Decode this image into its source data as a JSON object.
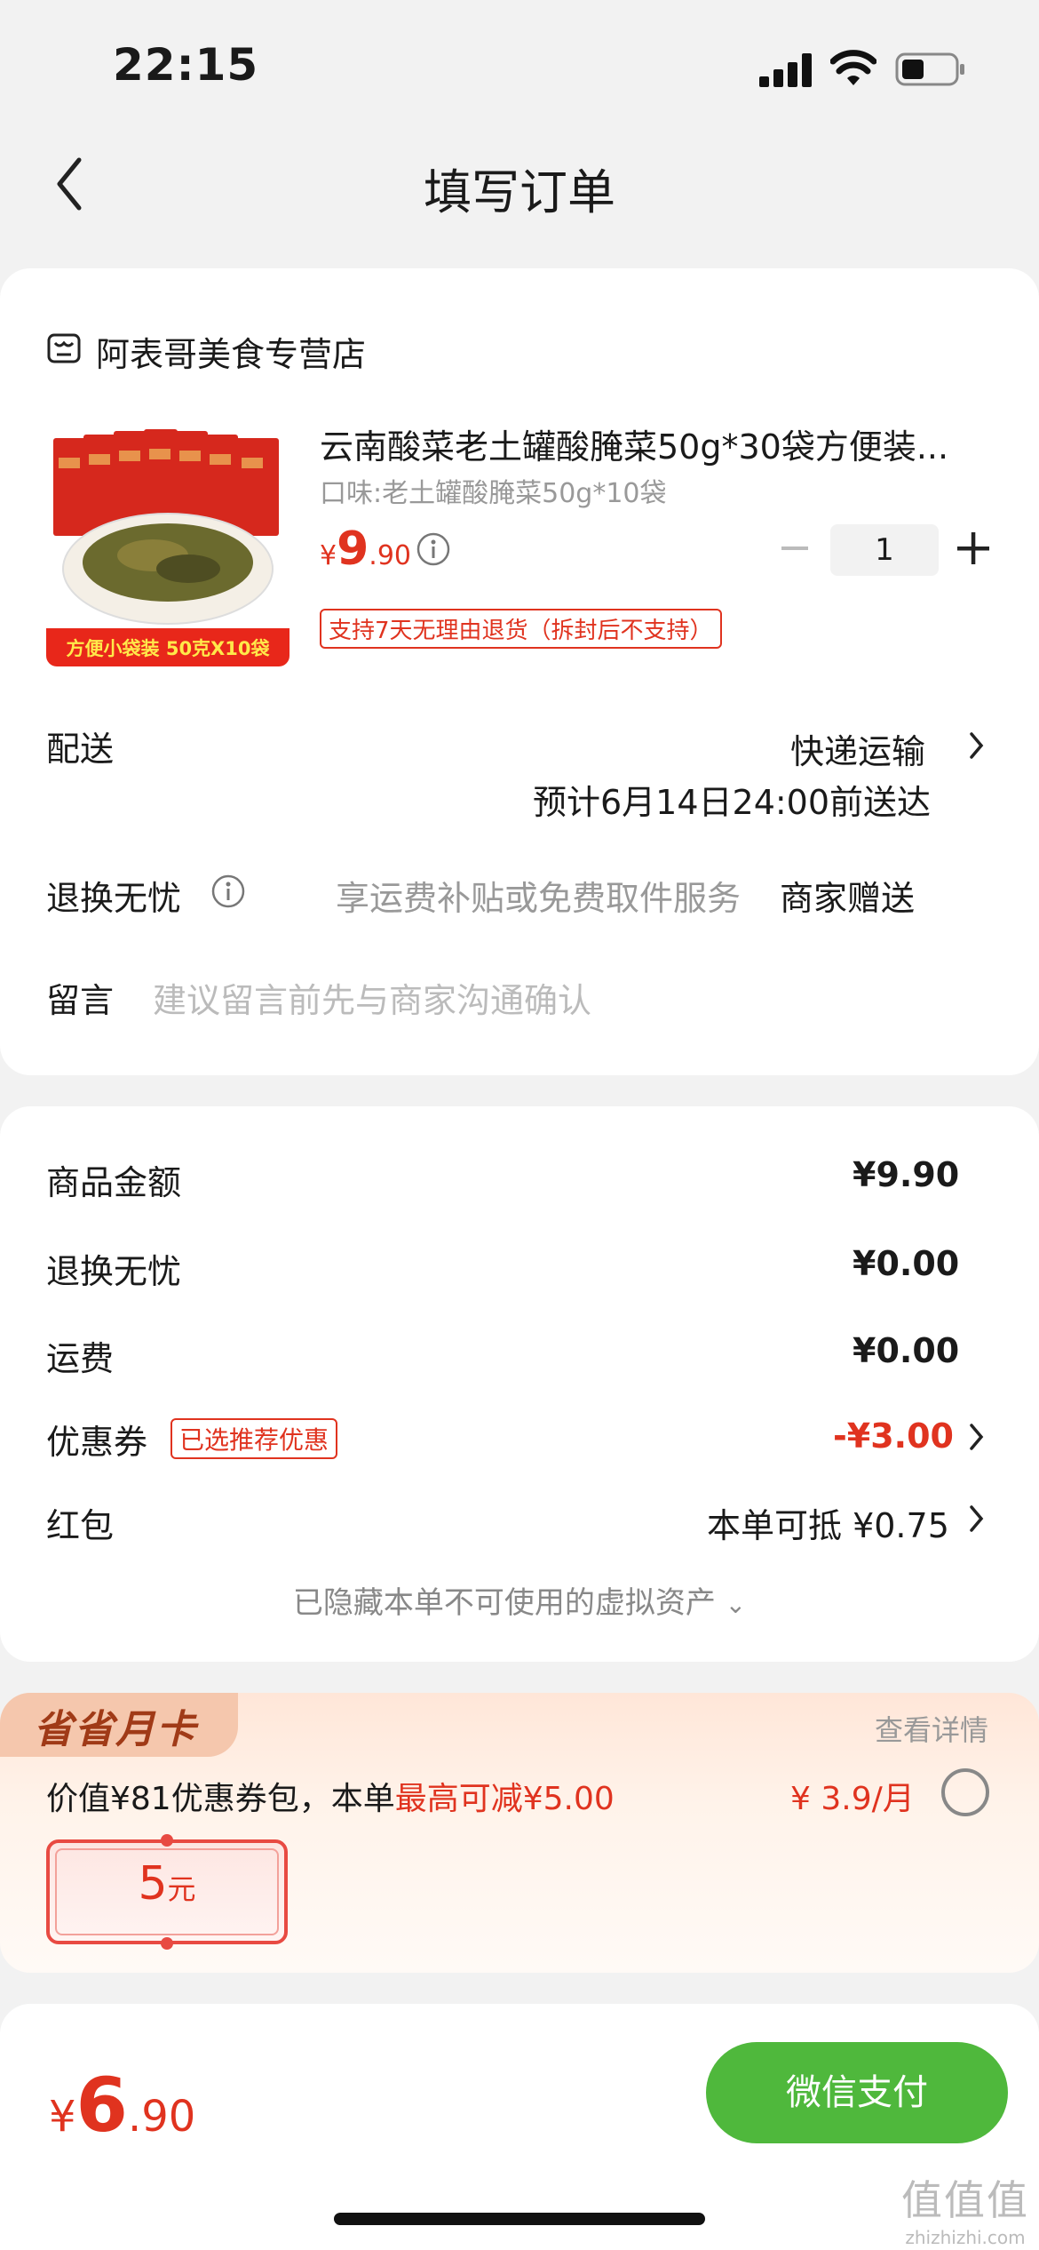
{
  "status_bar": {
    "time": "22:15"
  },
  "nav": {
    "title": "填写订单"
  },
  "store": {
    "name": "阿表哥美食专营店"
  },
  "product": {
    "name": "云南酸菜老土罐酸腌菜50g*30袋方便装...",
    "spec": "口味:老土罐酸腌菜50g*10袋",
    "price_currency": "¥",
    "price_int": "9",
    "price_dec": ".90",
    "quantity": "1",
    "return_tag": "支持7天无理由退货（拆封后不支持）",
    "image_banner": "方便小袋装 50克X10袋"
  },
  "delivery": {
    "label": "配送",
    "method": "快递运输",
    "eta": "预计6月14日24:00前送达"
  },
  "worry_free": {
    "label": "退换无忧",
    "desc": "享运费补贴或免费取件服务",
    "value": "商家赠送"
  },
  "message": {
    "label": "留言",
    "placeholder": "建议留言前先与商家沟通确认"
  },
  "summary": {
    "rows": [
      {
        "label": "商品金额",
        "value": "¥9.90"
      },
      {
        "label": "退换无忧",
        "value": "¥0.00"
      },
      {
        "label": "运费",
        "value": "¥0.00"
      }
    ],
    "coupon": {
      "label": "优惠券",
      "tag": "已选推荐优惠",
      "value": "-¥3.00"
    },
    "redpacket": {
      "label": "红包",
      "value": "本单可抵 ¥0.75"
    },
    "hidden_assets": "已隐藏本单不可使用的虚拟资产"
  },
  "member_card": {
    "badge": "省省月卡",
    "detail": "查看详情",
    "desc_prefix": "价值¥81优惠券包，本单",
    "desc_highlight": "最高可减¥5.00",
    "price": "¥ 3.9/月",
    "coupon_amount": "5",
    "coupon_unit": "元"
  },
  "bottom_bar": {
    "total_currency": "¥",
    "total_int": "6",
    "total_dec": ".90",
    "pay_label": "微信支付"
  },
  "watermark": {
    "big": "值值值",
    "small": "zhizhizhi.com"
  },
  "colors": {
    "accent_red": "#e0331f",
    "pay_green": "#4fb83c"
  }
}
